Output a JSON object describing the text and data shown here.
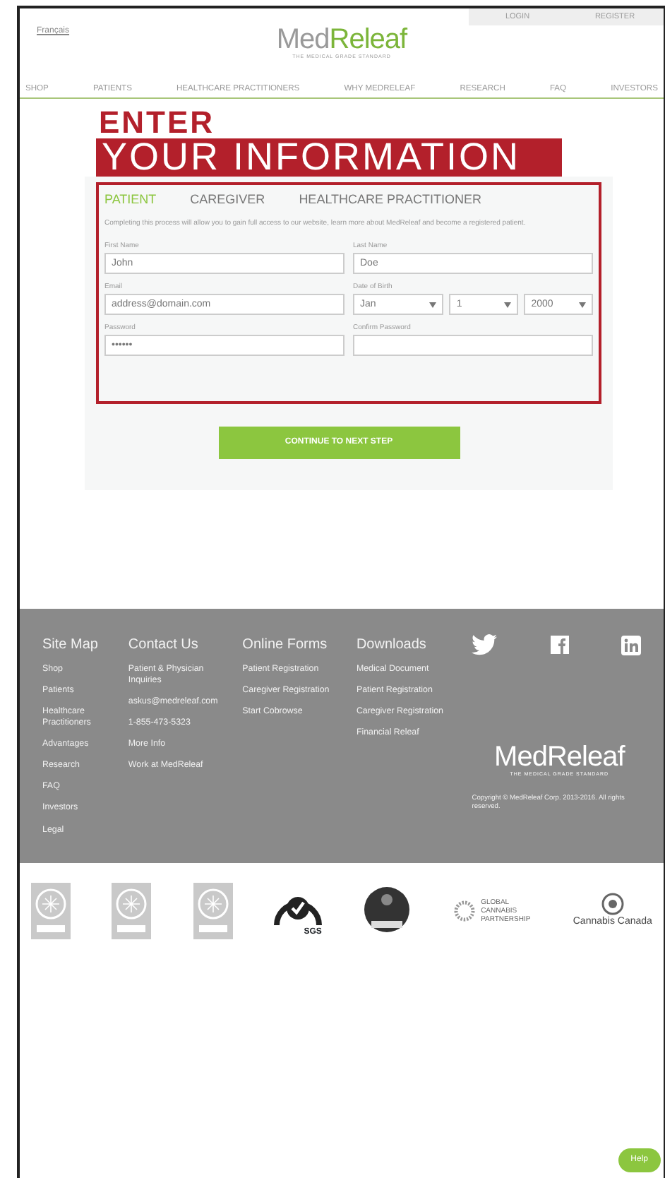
{
  "header": {
    "language_link": "Français",
    "account_links": [
      "LOGIN",
      "REGISTER"
    ],
    "logo": {
      "name_start": "Med",
      "name_end": "Releaf",
      "tagline": "THE MEDICAL GRADE STANDARD"
    }
  },
  "nav": [
    "SHOP",
    "PATIENTS",
    "HEALTHCARE PRACTITIONERS",
    "WHY MEDRELEAF",
    "RESEARCH",
    "FAQ",
    "INVESTORS"
  ],
  "heading": {
    "line1": "ENTER",
    "line2": "YOUR INFORMATION"
  },
  "form": {
    "tabs": [
      {
        "label": "PATIENT",
        "selected": true
      },
      {
        "label": "CAREGIVER",
        "selected": false
      },
      {
        "label": "HEALTHCARE PRACTITIONER",
        "selected": false
      }
    ],
    "description": "Completing this process will allow you to gain full access to our website, learn more about MedReleaf and become a registered patient.",
    "fields": [
      {
        "kind": "text",
        "label": "First Name",
        "value": "John"
      },
      {
        "kind": "text",
        "label": "Last Name",
        "value": "Doe"
      },
      {
        "kind": "text",
        "label": "Email",
        "value": "address@domain.com"
      },
      {
        "kind": "date",
        "label": "Date of Birth",
        "selects": [
          "Jan",
          "1",
          "2000"
        ]
      },
      {
        "kind": "text",
        "label": "Password",
        "value": "••••••"
      },
      {
        "kind": "text",
        "label": "Confirm Password"
      }
    ],
    "submit": "CONTINUE TO NEXT STEP"
  },
  "footer": {
    "columns": [
      {
        "title": "Site Map",
        "links": [
          "Shop",
          "Patients",
          "Healthcare Practitioners",
          "Advantages",
          "Research",
          "FAQ",
          "Investors",
          "Legal"
        ]
      },
      {
        "title": "Contact Us",
        "links": [
          "Patient & Physician Inquiries",
          "askus@medreleaf.com",
          "1-855-473-5323",
          "More Info",
          "Work at MedReleaf"
        ]
      },
      {
        "title": "Online Forms",
        "links": [
          "Patient Registration",
          "Caregiver Registration",
          "Start Cobrowse"
        ]
      },
      {
        "title": "Downloads",
        "links": [
          "Medical Document",
          "Patient Registration",
          "Caregiver Registration",
          "Financial Releaf"
        ]
      }
    ],
    "logo": {
      "name_start": "Med",
      "name_end": "Releaf",
      "tagline": "THE MEDICAL GRADE STANDARD"
    },
    "copyright": "Copyright © MedReleaf Corp. 2013-2016. All rights reserved."
  },
  "badges": [
    {
      "kind": "seal"
    },
    {
      "kind": "seal"
    },
    {
      "kind": "seal"
    },
    {
      "kind": "check",
      "text": "SGS"
    },
    {
      "kind": "medal"
    },
    {
      "kind": "partnership",
      "text": "GLOBAL CANNABIS PARTNERSHIP"
    },
    {
      "kind": "brand",
      "text": "Cannabis Canada"
    }
  ],
  "help_button": "Help"
}
